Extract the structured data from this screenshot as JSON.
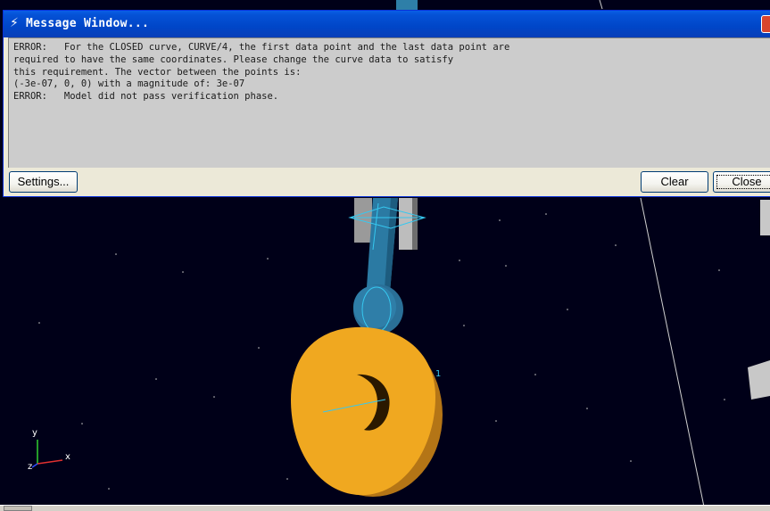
{
  "message_window": {
    "title": "Message Window...",
    "lines": [
      "ERROR:   For the CLOSED curve, CURVE/4, the first data point and the last data point are",
      "required to have the same coordinates. Please change the curve data to satisfy",
      "this requirement. The vector between the points is:",
      "(-3e-07, 0, 0) with a magnitude of: 3e-07",
      "ERROR:   Model did not pass verification phase."
    ],
    "buttons": {
      "settings": "Settings...",
      "clear": "Clear",
      "close": "Close"
    }
  },
  "viewport": {
    "marker_label": "1",
    "triad": {
      "x": "x",
      "y": "y",
      "z": "z"
    }
  },
  "colors": {
    "background": "#000018",
    "cam": "#f0a820",
    "follower": "#2e7fa8",
    "titlebar": "#0052d6"
  }
}
